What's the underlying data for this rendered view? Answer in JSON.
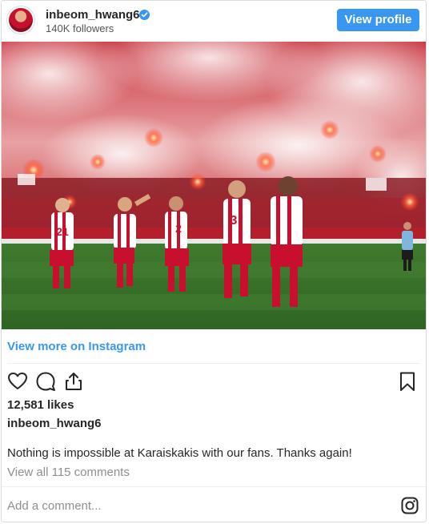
{
  "header": {
    "username": "inbeom_hwang6",
    "followers": "140K followers",
    "view_profile_label": "View profile"
  },
  "post": {
    "view_more_label": "View more on Instagram",
    "likes": "12,581 likes",
    "owner": "inbeom_hwang6",
    "caption": "Nothing is impossible at Karaiskakis with our fans. Thanks again!",
    "comments_link": "View all 115 comments",
    "add_comment_placeholder": "Add a comment..."
  },
  "photo": {
    "jersey_numbers": [
      "21",
      "2",
      "3",
      "2"
    ]
  },
  "colors": {
    "accent": "#3897f0",
    "team_red": "#c8102e",
    "pitch_green": "#3f7a2e"
  },
  "icons": [
    "verified-badge-icon",
    "heart-icon",
    "comment-icon",
    "share-icon",
    "bookmark-icon",
    "instagram-icon"
  ]
}
